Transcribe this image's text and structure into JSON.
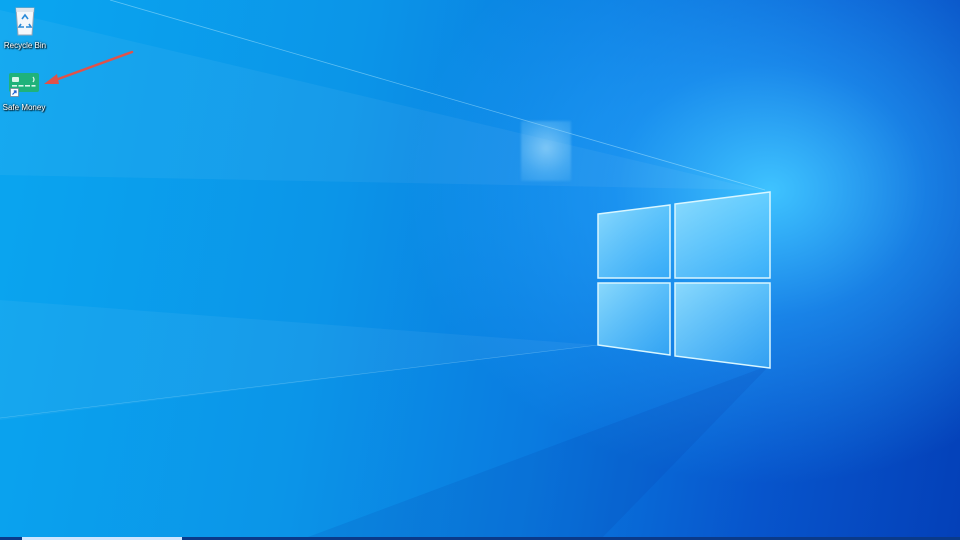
{
  "desktop": {
    "icons": [
      {
        "label": "Recycle Bin",
        "icon": "recycle-bin-icon"
      },
      {
        "label": "Safe Money",
        "icon": "credit-card-icon",
        "shortcut": true
      }
    ]
  },
  "annotation": {
    "type": "arrow",
    "color": "#e0524a",
    "target": "Safe Money"
  },
  "colors": {
    "wallpaper_light": "#0aa6f0",
    "wallpaper_dark": "#0440b8",
    "glow": "#3fc3ff",
    "card_green": "#1fb27a"
  }
}
